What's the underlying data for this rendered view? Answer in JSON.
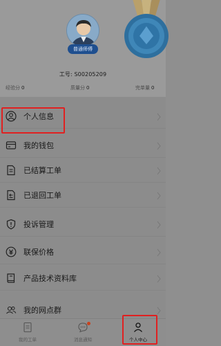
{
  "profile": {
    "role_badge": "普通师傅",
    "worker_no": "工号: S00205209",
    "scores": [
      {
        "label": "经验分",
        "value": "0"
      },
      {
        "label": "质量分",
        "value": "0"
      },
      {
        "label": "完单量",
        "value": "0"
      }
    ]
  },
  "menu": {
    "items": [
      {
        "label": "个人信息",
        "icon": "user-circle-icon"
      },
      {
        "label": "我的钱包",
        "icon": "wallet-icon"
      },
      {
        "label": "已结算工单",
        "icon": "document-icon"
      },
      {
        "label": "已退回工单",
        "icon": "returned-document-icon"
      },
      {
        "label": "投诉管理",
        "icon": "shield-alert-icon"
      },
      {
        "label": "联保价格",
        "icon": "price-icon"
      },
      {
        "label": "产品技术资料库",
        "icon": "book-icon"
      },
      {
        "label": "我的网点群",
        "icon": "group-icon"
      }
    ]
  },
  "tabbar": {
    "tabs": [
      {
        "label": "我的工单",
        "icon": "order-icon"
      },
      {
        "label": "消息通知",
        "icon": "message-icon"
      },
      {
        "label": "个人中心",
        "icon": "person-icon"
      }
    ]
  },
  "colors": {
    "highlight": "#e02020",
    "badge": "#1f4f8f",
    "notification_dot": "#c8421e"
  }
}
